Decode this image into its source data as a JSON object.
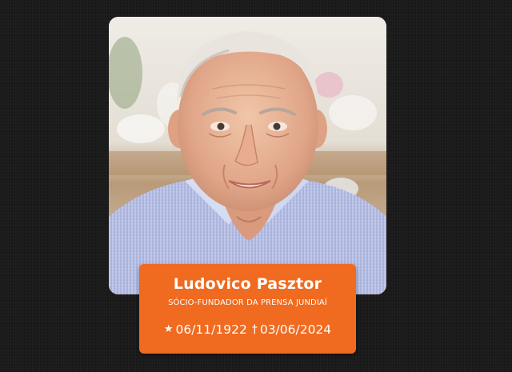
{
  "memorial": {
    "name": "Ludovico Pasztor",
    "role": "SÓCIO-FUNDADOR DA PRENSA JUNDIAÍ",
    "birth_symbol": "★",
    "birth_date": "06/11/1922",
    "death_symbol": "†",
    "death_date": "03/06/2024"
  },
  "colors": {
    "background": "#1a1a1a",
    "accent": "#f06a1f",
    "text_on_accent": "#ffffff"
  }
}
